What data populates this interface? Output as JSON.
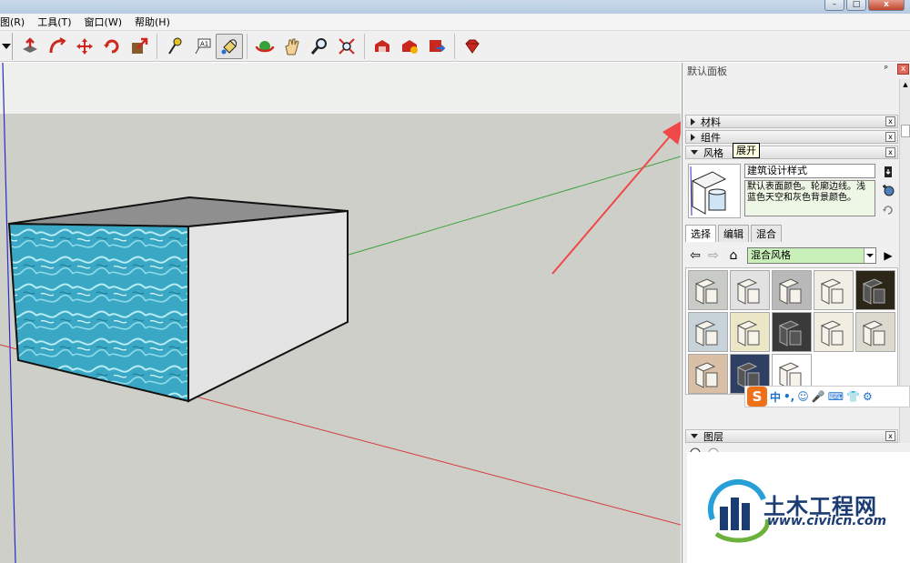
{
  "window": {
    "minimize_glyph": "–",
    "maximize_glyph": "□",
    "close_glyph": "x"
  },
  "menu": [
    "图(R)",
    "工具(T)",
    "窗口(W)",
    "帮助(H)"
  ],
  "toolbar": {
    "buttons": [
      "push-pull-icon",
      "follow-me-icon",
      "move-icon",
      "rotate-icon",
      "scale-icon",
      "tape-measure-icon",
      "text-label-icon",
      "paint-bucket-icon",
      "orbit-icon",
      "pan-icon",
      "zoom-icon",
      "zoom-extents-icon",
      "warehouse-icon",
      "share-model-icon",
      "extension-icon",
      "ruby-icon"
    ],
    "active": "paint-bucket-icon"
  },
  "panel": {
    "title": "默认面板",
    "pin_glyph": "ᵖ",
    "close_glyph": "x",
    "trays": {
      "materials": "材料",
      "components": "组件",
      "styles": "风格",
      "layers": "图层"
    },
    "tooltip": "展开",
    "style_name": "建筑设计样式",
    "style_description": "默认表面颜色。轮廓边线。浅蓝色天空和灰色背景颜色。",
    "tabs": [
      "选择",
      "编辑",
      "混合"
    ],
    "active_tab": "选择",
    "collection": "混合风格",
    "swatch_colors": [
      "#c9cbc7",
      "#e2e2e2",
      "#b9b9b9",
      "#f0efe6",
      "#2b2618",
      "#c8d2d9",
      "#ece8c7",
      "#3a3a3a",
      "#f1ede0",
      "#dcd9cf",
      "#d9bfa5",
      "#2e3f63",
      "#ffffff"
    ]
  },
  "ime": {
    "logo": "S",
    "items": [
      "中",
      "•,",
      "☺",
      "🎤",
      "⌨",
      "👕",
      "⚙"
    ]
  },
  "watermark": {
    "name": "土木工程网",
    "url": "www.civilcn.com"
  },
  "colors": {
    "sky": "#eef0ee",
    "ground": "#cfcfca",
    "axis_red": "#d33a3a",
    "axis_green": "#3ea33e",
    "axis_blue": "#2b2bc8",
    "arrow": "#f04848",
    "box_top": "#8f8f8f",
    "box_side": "#e4e4e4",
    "water": "#3aa8c4"
  }
}
